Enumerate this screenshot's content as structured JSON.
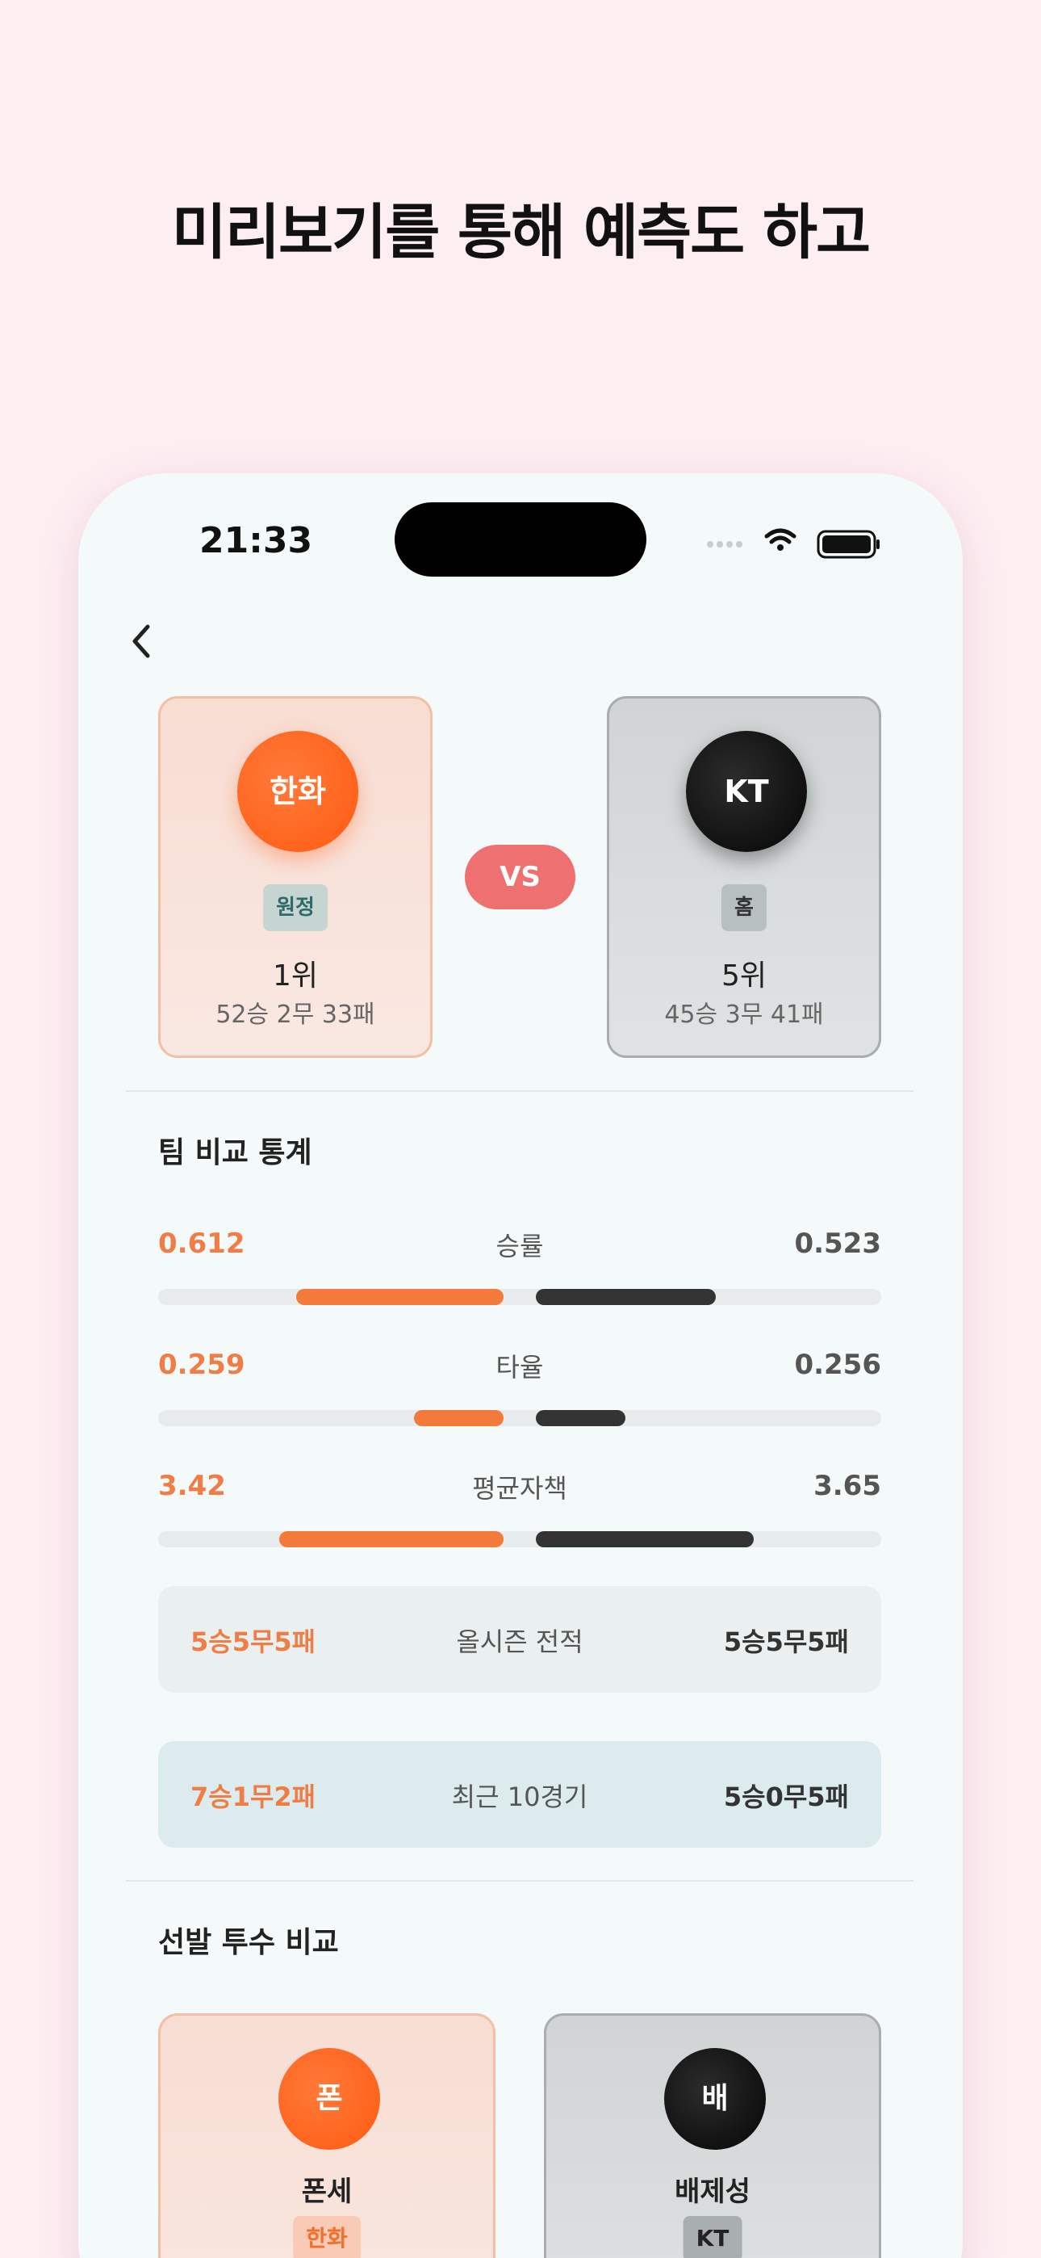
{
  "headline": "미리보기를 통해 예측도 하고",
  "status_bar": {
    "time": "21:33"
  },
  "matchup": {
    "vs_label": "VS",
    "away": {
      "logo_text": "한화",
      "badge": "원정",
      "rank": "1위",
      "record": "52승 2무 33패",
      "color": "#ff5a10"
    },
    "home": {
      "logo_text": "KT",
      "badge": "홈",
      "rank": "5위",
      "record": "45승 3무 41패",
      "color": "#050505"
    }
  },
  "team_comparison": {
    "title": "팀 비교 통계",
    "stats": [
      {
        "label": "승률",
        "away_value": "0.612",
        "home_value": "0.523",
        "away_fill": 0.6,
        "home_fill": 0.52
      },
      {
        "label": "타율",
        "away_value": "0.259",
        "home_value": "0.256",
        "away_fill": 0.26,
        "home_fill": 0.26
      },
      {
        "label": "평균자책",
        "away_value": "3.42",
        "home_value": "3.65",
        "away_fill": 0.65,
        "home_fill": 0.63
      }
    ],
    "season_record": {
      "label": "올시즌 전적",
      "away": "5승5무5패",
      "home": "5승5무5패"
    },
    "recent_games": {
      "label": "최근 10경기",
      "away": "7승1무2패",
      "home": "5승0무5패"
    }
  },
  "pitcher_comparison": {
    "title": "선발 투수 비교",
    "away": {
      "initial": "폰",
      "name": "폰세",
      "team": "한화"
    },
    "home": {
      "initial": "배",
      "name": "배제성",
      "team": "KT"
    }
  }
}
